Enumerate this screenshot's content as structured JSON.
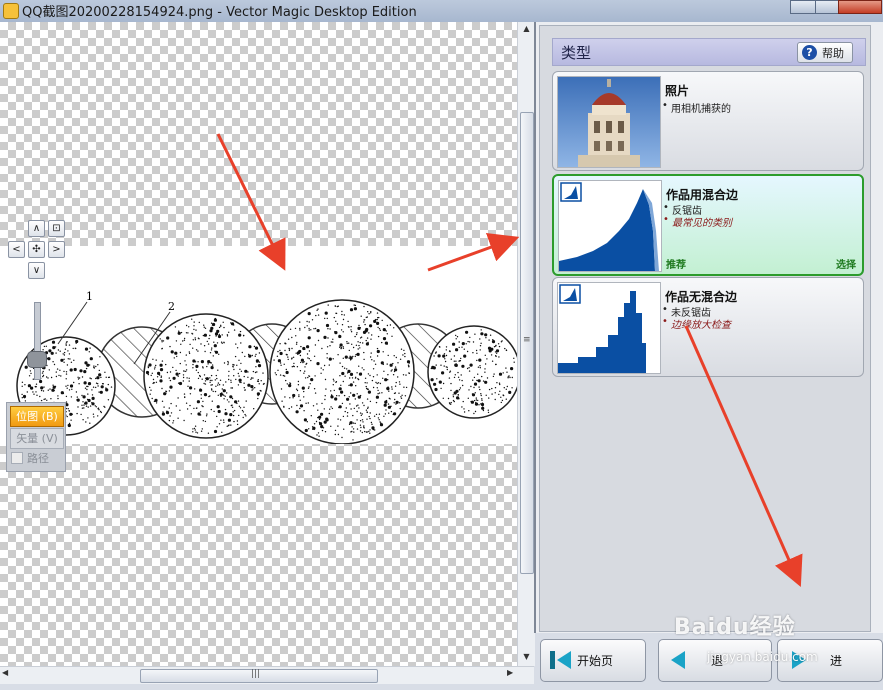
{
  "window": {
    "title": "QQ截图20200228154924.png - Vector Magic Desktop Edition"
  },
  "canvas": {
    "callouts": [
      "1",
      "2"
    ]
  },
  "mode_panel": {
    "bitmap_label": "位图 (B)",
    "vector_label": "矢量 (V)",
    "path_label": "路径"
  },
  "type_panel": {
    "header": "类型",
    "help_label": "帮助",
    "options": [
      {
        "title": "照片",
        "bullets": [
          "用相机捕获的"
        ]
      },
      {
        "title": "作品用混合边",
        "bullets": [
          "反锯齿",
          "最常见的类别"
        ],
        "recommend": "推荐",
        "select": "选择"
      },
      {
        "title": "作品无混合边",
        "bullets": [
          "未反锯齿",
          "边缘放大检查"
        ]
      }
    ]
  },
  "bottom_buttons": {
    "home": "开始页",
    "back": "退",
    "next": "进"
  },
  "watermark": {
    "brand": "Baidu经验",
    "url": "jingyan.baidu.com"
  },
  "colors": {
    "accent_orange": "#f19a12",
    "selected_green": "#2c9c2c",
    "annotation_red": "#e8402a",
    "chart_blue": "#0a4fa3"
  }
}
